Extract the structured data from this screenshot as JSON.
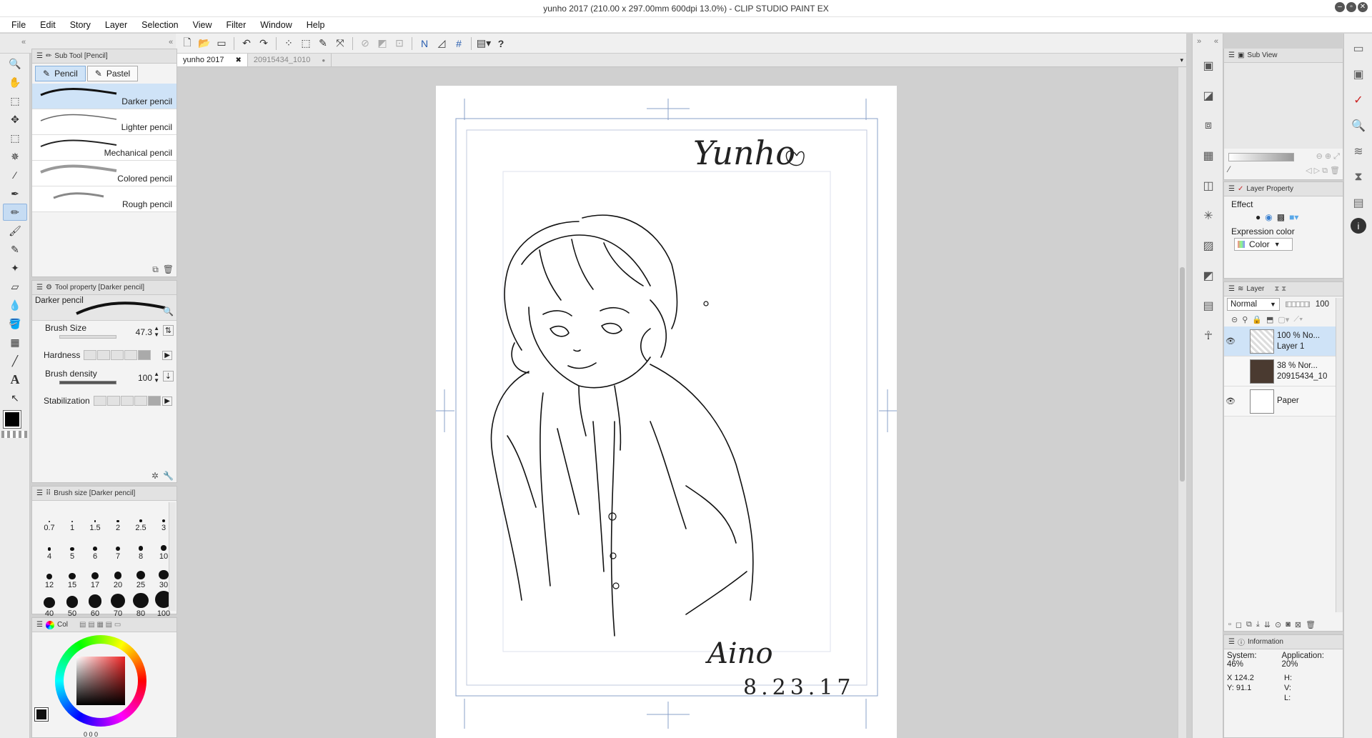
{
  "window": {
    "title": "yunho 2017 (210.00 x 297.00mm 600dpi 13.0%)  - CLIP STUDIO PAINT EX"
  },
  "menu": [
    "File",
    "Edit",
    "Story",
    "Layer",
    "Selection",
    "View",
    "Filter",
    "Window",
    "Help"
  ],
  "subtool": {
    "title": "Sub Tool [Pencil]",
    "tabs": [
      "Pencil",
      "Pastel"
    ],
    "brushes": [
      "Darker pencil",
      "Lighter pencil",
      "Mechanical pencil",
      "Colored pencil",
      "Rough pencil"
    ]
  },
  "toolprop": {
    "title": "Tool property [Darker pencil]",
    "preview_label": "Darker pencil",
    "brush_size_label": "Brush Size",
    "brush_size": "47.3",
    "hardness_label": "Hardness",
    "density_label": "Brush density",
    "density": "100",
    "stabilization_label": "Stabilization"
  },
  "brushsize": {
    "title": "Brush size [Darker pencil]",
    "values": [
      "0.7",
      "1",
      "1.5",
      "2",
      "2.5",
      "3",
      "4",
      "5",
      "6",
      "7",
      "8",
      "10",
      "12",
      "15",
      "17",
      "20",
      "25",
      "30",
      "40",
      "50",
      "60",
      "70",
      "80",
      "100"
    ]
  },
  "color": {
    "tab": "Col",
    "fg": "#000000",
    "readout": "0   0   0"
  },
  "doctabs": [
    "yunho 2017",
    "20915434_1010"
  ],
  "canvas": {
    "signature_top": "Yunho",
    "signature_bottom": "Aino",
    "date": "8.23.17"
  },
  "subview": {
    "title": "Sub View"
  },
  "layerprop": {
    "title": "Layer Property",
    "effect_label": "Effect",
    "expr_label": "Expression color",
    "expr_value": "Color"
  },
  "layers": {
    "title": "Layer",
    "blend": "Normal",
    "opacity": "100",
    "items": [
      {
        "meta": "100 %  No...",
        "name": "Layer 1",
        "selected": true,
        "visible": true
      },
      {
        "meta": "38 %  Nor...",
        "name": "20915434_10",
        "selected": false,
        "visible": false
      },
      {
        "meta": "",
        "name": "Paper",
        "selected": false,
        "visible": true
      }
    ]
  },
  "info": {
    "title": "Information",
    "system": "System: 46%",
    "application": "Application: 20%",
    "x": "X  124.2",
    "y": "Y:  91.1",
    "h": "H:",
    "v": "V:",
    "l": "L:"
  }
}
